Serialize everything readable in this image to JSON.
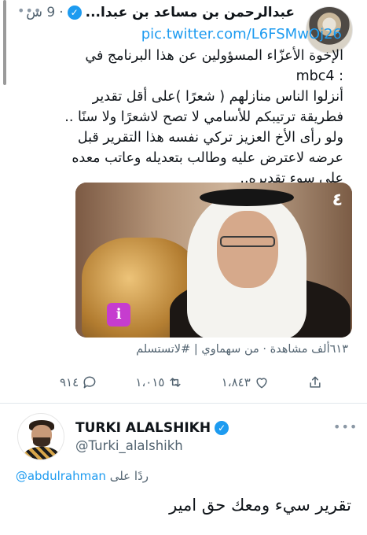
{
  "tweet1": {
    "name": "عبدالرحمن بن مساعد بن عبدا...",
    "time": "9 س",
    "link": "pic.twitter.com/L6FSMwOj26",
    "text_lines": [
      "الإخوة الأعزّاء المسؤولين عن هذا البرنامج في",
      "mbc4 :",
      "أنزلوا الناس منازلهم ( شعرًا )على أقل تقدير",
      "فطريقة ترتيبكم للأسامي لا تصح لاشعرًا ولا سنًا ..",
      "ولو رأى الأخ العزيز تركي نفسه هذا التقرير قبل",
      "عرضه لاعترض عليه وطالب بتعديله وعاتب معده",
      "على سوء تقديره.."
    ],
    "media_logo": "٤",
    "media_stamp": "ℹ",
    "views": "٦١٣ألف مشاهدة",
    "source": "من سهماوي",
    "hashtag": "#لاتستسلم",
    "actions": {
      "reply_count": "٩١٤",
      "retweet_count": "١،٠١٥",
      "like_count": "١،٨٤٣"
    }
  },
  "tweet2": {
    "name": "TURKI ALALSHIKH",
    "handle": "@Turki_alalshikh",
    "reply_prefix": "ردًا على",
    "reply_to": "@abdulrahman",
    "text": "تقرير سيء ومعك حق امير"
  },
  "icons": {
    "verified": "verified-badge-icon",
    "more": "more-options-icon",
    "reply": "reply-icon",
    "retweet": "retweet-icon",
    "like": "heart-icon",
    "share": "share-icon"
  },
  "colors": {
    "link": "#1d9bf0",
    "muted": "#536471",
    "verified": "#1d9bf0"
  }
}
